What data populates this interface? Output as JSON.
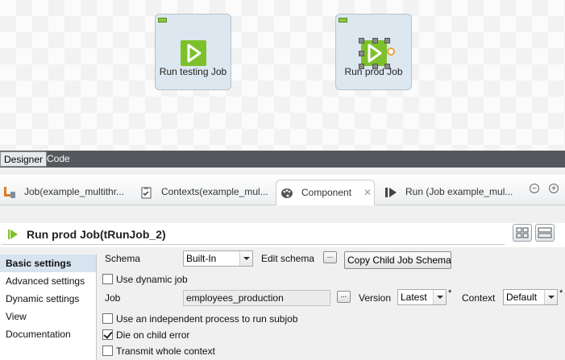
{
  "canvas": {
    "nodes": [
      {
        "label": "Run testing Job",
        "selected": false
      },
      {
        "label": "Run prod Job",
        "selected": true
      }
    ]
  },
  "designer_tabs": {
    "designer": "Designer",
    "code": "Code"
  },
  "views_tabs": [
    {
      "label": "Job(example_multithr...",
      "icon": "job-icon"
    },
    {
      "label": "Contexts(example_mul...",
      "icon": "contexts-icon"
    },
    {
      "label": "Component",
      "icon": "palette-icon",
      "active": true
    },
    {
      "label": "Run (Job example_mul...",
      "icon": "run-icon"
    }
  ],
  "component": {
    "title": "Run prod Job(tRunJob_2)"
  },
  "nav": [
    "Basic settings",
    "Advanced settings",
    "Dynamic settings",
    "View",
    "Documentation"
  ],
  "settings": {
    "schema_label": "Schema",
    "schema_value": "Built-In",
    "edit_schema_label": "Edit schema",
    "dots": "...",
    "copy_child_button": "Copy Child Job Schema",
    "use_dynamic_job": "Use dynamic job",
    "job_label": "Job",
    "job_value": "employees_production",
    "version_label": "Version",
    "version_value": "Latest",
    "context_label": "Context",
    "context_value": "Default",
    "required_mark": "*",
    "independent_process": "Use an independent process to run subjob",
    "die_on_child_error": "Die on child error",
    "die_on_child_error_checked": true,
    "transmit_whole_context": "Transmit whole context"
  },
  "colors": {
    "accent_green": "#7dc12a",
    "dark_bar": "#55595d",
    "active_nav": "#d7e3ef"
  }
}
